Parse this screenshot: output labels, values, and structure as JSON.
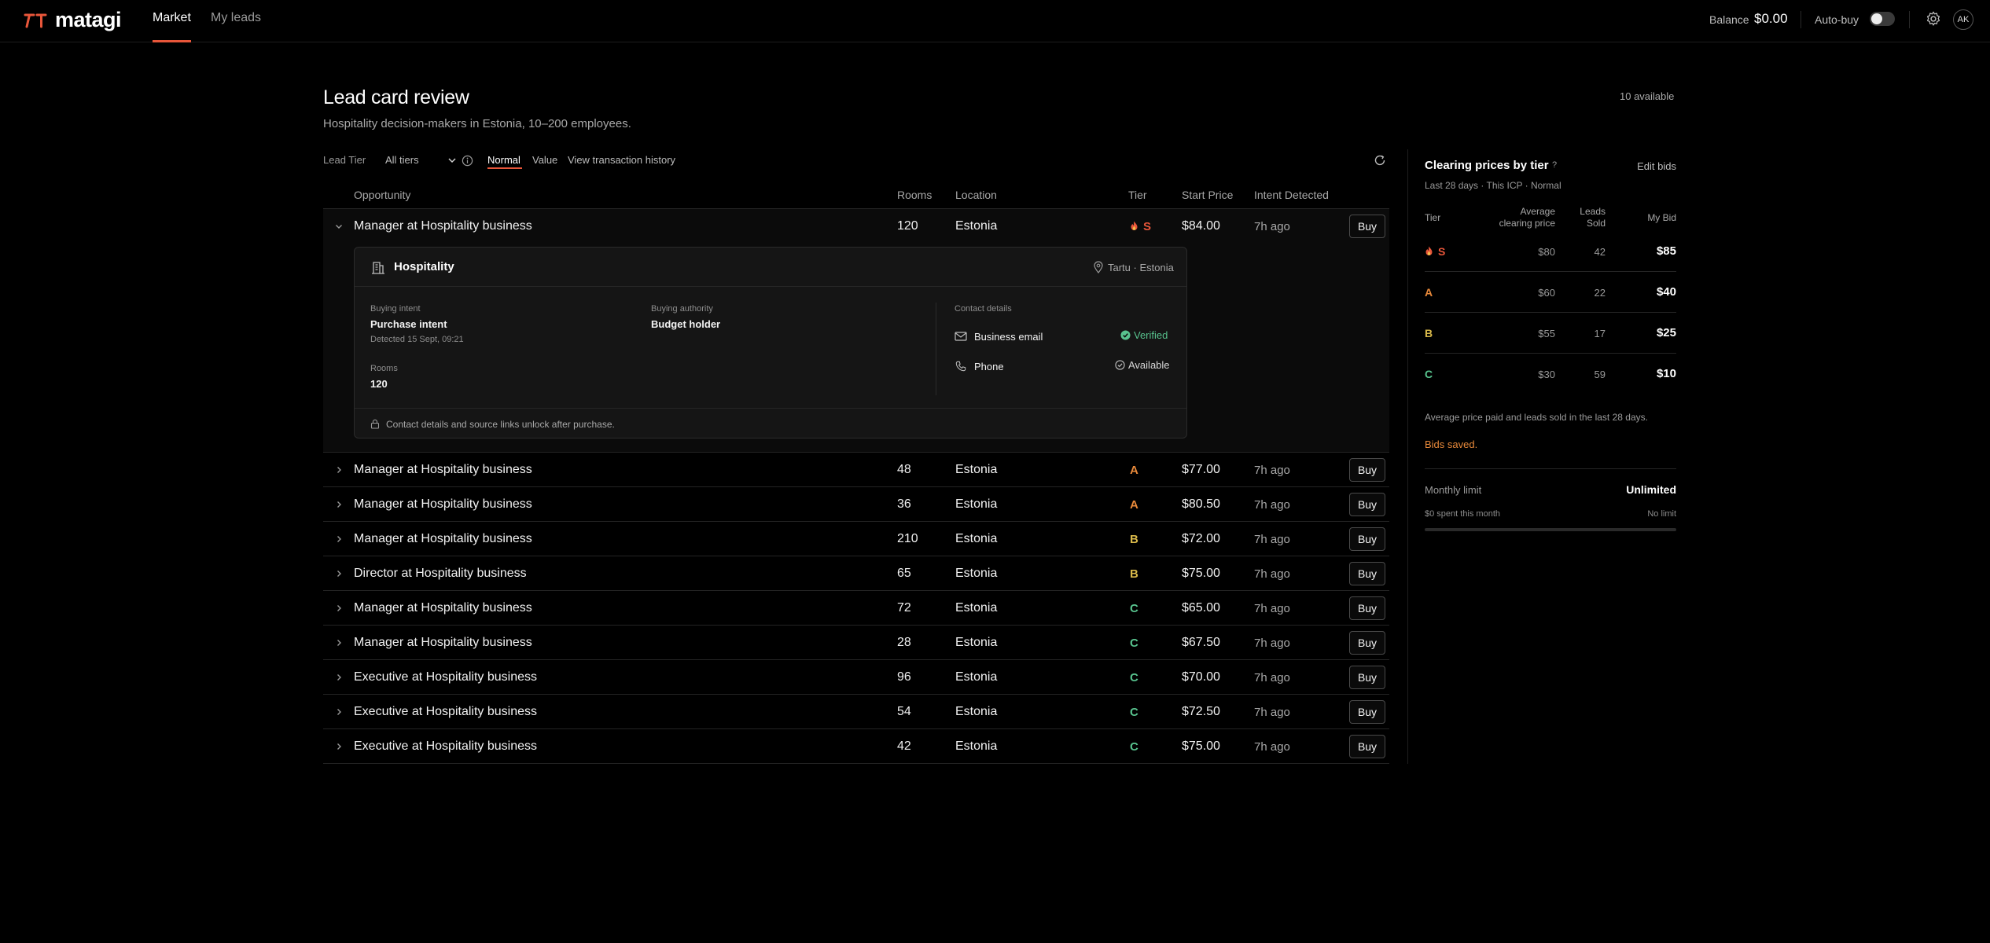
{
  "app": {
    "name": "matagi"
  },
  "nav": {
    "tabs": [
      {
        "label": "Market",
        "active": true
      },
      {
        "label": "My leads",
        "active": false
      }
    ]
  },
  "topbar": {
    "balance_label": "Balance",
    "balance_value": "$0.00",
    "autobuy_label": "Auto-buy",
    "autobuy_on": false,
    "avatar_initials": "AK"
  },
  "header": {
    "title": "Lead card review",
    "subtitle": "Hospitality decision-makers in Estonia, 10–200 employees.",
    "available": "10 available"
  },
  "filters": {
    "tier_label": "Lead Tier",
    "tier_value": "All tiers",
    "mode_normal": "Normal",
    "mode_value": "Value",
    "history_link": "View transaction history"
  },
  "table": {
    "columns": [
      "Opportunity",
      "Rooms",
      "Location",
      "Tier",
      "Start Price",
      "Intent Detected"
    ],
    "buy_label": "Buy",
    "rows": [
      {
        "title": "Manager at Hospitality business",
        "rooms": "120",
        "location": "Estonia",
        "tier": "S",
        "price": "$84.00",
        "intent": "7h ago"
      },
      {
        "title": "Manager at Hospitality business",
        "rooms": "48",
        "location": "Estonia",
        "tier": "A",
        "price": "$77.00",
        "intent": "7h ago"
      },
      {
        "title": "Manager at Hospitality business",
        "rooms": "36",
        "location": "Estonia",
        "tier": "A",
        "price": "$80.50",
        "intent": "7h ago"
      },
      {
        "title": "Manager at Hospitality business",
        "rooms": "210",
        "location": "Estonia",
        "tier": "B",
        "price": "$72.00",
        "intent": "7h ago"
      },
      {
        "title": "Director at Hospitality business",
        "rooms": "65",
        "location": "Estonia",
        "tier": "B",
        "price": "$75.00",
        "intent": "7h ago"
      },
      {
        "title": "Manager at Hospitality business",
        "rooms": "72",
        "location": "Estonia",
        "tier": "C",
        "price": "$65.00",
        "intent": "7h ago"
      },
      {
        "title": "Manager at Hospitality business",
        "rooms": "28",
        "location": "Estonia",
        "tier": "C",
        "price": "$67.50",
        "intent": "7h ago"
      },
      {
        "title": "Executive at Hospitality business",
        "rooms": "96",
        "location": "Estonia",
        "tier": "C",
        "price": "$70.00",
        "intent": "7h ago"
      },
      {
        "title": "Executive at Hospitality business",
        "rooms": "54",
        "location": "Estonia",
        "tier": "C",
        "price": "$72.50",
        "intent": "7h ago"
      },
      {
        "title": "Executive at Hospitality business",
        "rooms": "42",
        "location": "Estonia",
        "tier": "C",
        "price": "$75.00",
        "intent": "7h ago"
      }
    ]
  },
  "detail": {
    "company": "Hospitality",
    "location": "Tartu · Estonia",
    "buying_intent_label": "Buying intent",
    "buying_intent_value": "Purchase intent",
    "detected": "Detected 15 Sept, 09:21",
    "buying_authority_label": "Buying authority",
    "buying_authority_value": "Budget holder",
    "rooms_label": "Rooms",
    "rooms_value": "120",
    "contact_label": "Contact details",
    "email_label": "Business email",
    "email_status": "Verified",
    "phone_label": "Phone",
    "phone_status": "Available",
    "footer": "Contact details and source links unlock after purchase."
  },
  "panel": {
    "title": "Clearing prices by tier",
    "help": "?",
    "edit": "Edit bids",
    "subtitle": "Last 28 days · This ICP · Normal",
    "col_tier": "Tier",
    "col_avg_line1": "Average",
    "col_avg_line2": "clearing price",
    "col_sold_line1": "Leads",
    "col_sold_line2": "Sold",
    "col_bid": "My Bid",
    "rows": [
      {
        "tier": "S",
        "avg": "$80",
        "sold": "42",
        "bid": "$85"
      },
      {
        "tier": "A",
        "avg": "$60",
        "sold": "22",
        "bid": "$40"
      },
      {
        "tier": "B",
        "avg": "$55",
        "sold": "17",
        "bid": "$25"
      },
      {
        "tier": "C",
        "avg": "$30",
        "sold": "59",
        "bid": "$10"
      }
    ],
    "note": "Average price paid and leads sold in the last 28 days.",
    "saved": "Bids saved.",
    "monthly_label": "Monthly limit",
    "monthly_value": "Unlimited",
    "spent": "$0 spent this month",
    "no_limit": "No limit",
    "limit_used_fraction": 0
  },
  "colors": {
    "accent": "#e8563a",
    "tier_S": "#e8563a",
    "tier_A": "#e8893a",
    "tier_B": "#d9b94a",
    "tier_C": "#58c38e",
    "verified": "#58c38e"
  }
}
